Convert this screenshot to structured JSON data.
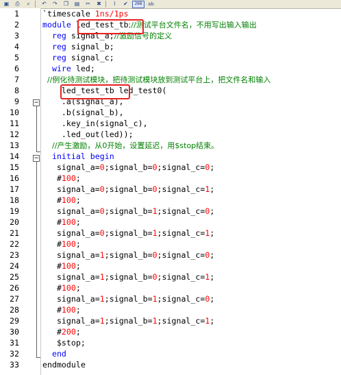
{
  "toolbar": {
    "buttons": [
      "save-icon",
      "print-icon",
      "find-icon",
      "undo-icon",
      "redo-icon",
      "copy-icon",
      "paste-icon",
      "cut-icon",
      "delete-icon",
      "paperclip-icon",
      "check-icon"
    ],
    "badge": "268",
    "ab_label": "ab"
  },
  "lines": [
    {
      "n": "1",
      "segs": [
        {
          "t": "`timescale ",
          "c": "tx"
        },
        {
          "t": "1ns/1ps",
          "c": "num"
        }
      ]
    },
    {
      "n": "2",
      "segs": [
        {
          "t": "module ",
          "c": "kw"
        },
        {
          "t": "led_test_tb",
          "c": "tx"
        },
        {
          "t": ";//测试平台文件名，不用写出输入输出",
          "c": "cm"
        }
      ]
    },
    {
      "n": "3",
      "segs": [
        {
          "t": "  reg ",
          "c": "kw"
        },
        {
          "t": "signal_a;",
          "c": "tx"
        },
        {
          "t": "//激励信号的定义",
          "c": "cm"
        }
      ]
    },
    {
      "n": "4",
      "segs": [
        {
          "t": "  reg ",
          "c": "kw"
        },
        {
          "t": "signal_b;",
          "c": "tx"
        }
      ]
    },
    {
      "n": "5",
      "segs": [
        {
          "t": "  reg ",
          "c": "kw"
        },
        {
          "t": "signal_c;",
          "c": "tx"
        }
      ]
    },
    {
      "n": "6",
      "segs": [
        {
          "t": "  wire ",
          "c": "kw"
        },
        {
          "t": "led;",
          "c": "tx"
        }
      ]
    },
    {
      "n": "7",
      "segs": [
        {
          "t": "  //例化待测试模块，把待测试模块放到测试平台上，把文件名和输入",
          "c": "cm"
        }
      ]
    },
    {
      "n": "8",
      "segs": [
        {
          "t": "    led_test_tb led_test0(",
          "c": "tx"
        }
      ]
    },
    {
      "n": "9",
      "segs": [
        {
          "t": "    .a(signal_a),",
          "c": "tx"
        }
      ]
    },
    {
      "n": "10",
      "segs": [
        {
          "t": "    .b(signal_b),",
          "c": "tx"
        }
      ]
    },
    {
      "n": "11",
      "segs": [
        {
          "t": "    .key_in(signal_c),",
          "c": "tx"
        }
      ]
    },
    {
      "n": "12",
      "segs": [
        {
          "t": "    .led_out(led));",
          "c": "tx"
        }
      ]
    },
    {
      "n": "13",
      "segs": [
        {
          "t": "    //产生激励，从0开始，设置延迟，用$stop结束。",
          "c": "cm"
        }
      ]
    },
    {
      "n": "14",
      "segs": [
        {
          "t": "  initial begin",
          "c": "kw"
        }
      ]
    },
    {
      "n": "15",
      "segs": [
        {
          "t": "   signal_a=",
          "c": "tx"
        },
        {
          "t": "0",
          "c": "num"
        },
        {
          "t": ";signal_b=",
          "c": "tx"
        },
        {
          "t": "0",
          "c": "num"
        },
        {
          "t": ";signal_c=",
          "c": "tx"
        },
        {
          "t": "0",
          "c": "num"
        },
        {
          "t": ";",
          "c": "tx"
        }
      ]
    },
    {
      "n": "16",
      "segs": [
        {
          "t": "   #",
          "c": "tx"
        },
        {
          "t": "100",
          "c": "num"
        },
        {
          "t": ";",
          "c": "tx"
        }
      ]
    },
    {
      "n": "17",
      "segs": [
        {
          "t": "   signal_a=",
          "c": "tx"
        },
        {
          "t": "0",
          "c": "num"
        },
        {
          "t": ";signal_b=",
          "c": "tx"
        },
        {
          "t": "0",
          "c": "num"
        },
        {
          "t": ";signal_c=",
          "c": "tx"
        },
        {
          "t": "1",
          "c": "num"
        },
        {
          "t": ";",
          "c": "tx"
        }
      ]
    },
    {
      "n": "18",
      "segs": [
        {
          "t": "   #",
          "c": "tx"
        },
        {
          "t": "100",
          "c": "num"
        },
        {
          "t": ";",
          "c": "tx"
        }
      ]
    },
    {
      "n": "19",
      "segs": [
        {
          "t": "   signal_a=",
          "c": "tx"
        },
        {
          "t": "0",
          "c": "num"
        },
        {
          "t": ";signal_b=",
          "c": "tx"
        },
        {
          "t": "1",
          "c": "num"
        },
        {
          "t": ";signal_c=",
          "c": "tx"
        },
        {
          "t": "0",
          "c": "num"
        },
        {
          "t": ";",
          "c": "tx"
        }
      ]
    },
    {
      "n": "20",
      "segs": [
        {
          "t": "   #",
          "c": "tx"
        },
        {
          "t": "100",
          "c": "num"
        },
        {
          "t": ";",
          "c": "tx"
        }
      ]
    },
    {
      "n": "21",
      "segs": [
        {
          "t": "   signal_a=",
          "c": "tx"
        },
        {
          "t": "0",
          "c": "num"
        },
        {
          "t": ";signal_b=",
          "c": "tx"
        },
        {
          "t": "1",
          "c": "num"
        },
        {
          "t": ";signal_c=",
          "c": "tx"
        },
        {
          "t": "1",
          "c": "num"
        },
        {
          "t": ";",
          "c": "tx"
        }
      ]
    },
    {
      "n": "22",
      "segs": [
        {
          "t": "   #",
          "c": "tx"
        },
        {
          "t": "100",
          "c": "num"
        },
        {
          "t": ";",
          "c": "tx"
        }
      ]
    },
    {
      "n": "23",
      "segs": [
        {
          "t": "   signal_a=",
          "c": "tx"
        },
        {
          "t": "1",
          "c": "num"
        },
        {
          "t": ";signal_b=",
          "c": "tx"
        },
        {
          "t": "0",
          "c": "num"
        },
        {
          "t": ";signal_c=",
          "c": "tx"
        },
        {
          "t": "0",
          "c": "num"
        },
        {
          "t": ";",
          "c": "tx"
        }
      ]
    },
    {
      "n": "24",
      "segs": [
        {
          "t": "   #",
          "c": "tx"
        },
        {
          "t": "100",
          "c": "num"
        },
        {
          "t": ";",
          "c": "tx"
        }
      ]
    },
    {
      "n": "25",
      "segs": [
        {
          "t": "   signal_a=",
          "c": "tx"
        },
        {
          "t": "1",
          "c": "num"
        },
        {
          "t": ";signal_b=",
          "c": "tx"
        },
        {
          "t": "0",
          "c": "num"
        },
        {
          "t": ";signal_c=",
          "c": "tx"
        },
        {
          "t": "1",
          "c": "num"
        },
        {
          "t": ";",
          "c": "tx"
        }
      ]
    },
    {
      "n": "26",
      "segs": [
        {
          "t": "   #",
          "c": "tx"
        },
        {
          "t": "100",
          "c": "num"
        },
        {
          "t": ";",
          "c": "tx"
        }
      ]
    },
    {
      "n": "27",
      "segs": [
        {
          "t": "   signal_a=",
          "c": "tx"
        },
        {
          "t": "1",
          "c": "num"
        },
        {
          "t": ";signal_b=",
          "c": "tx"
        },
        {
          "t": "1",
          "c": "num"
        },
        {
          "t": ";signal_c=",
          "c": "tx"
        },
        {
          "t": "0",
          "c": "num"
        },
        {
          "t": ";",
          "c": "tx"
        }
      ]
    },
    {
      "n": "28",
      "segs": [
        {
          "t": "   #",
          "c": "tx"
        },
        {
          "t": "100",
          "c": "num"
        },
        {
          "t": ";",
          "c": "tx"
        }
      ]
    },
    {
      "n": "29",
      "segs": [
        {
          "t": "   signal_a=",
          "c": "tx"
        },
        {
          "t": "1",
          "c": "num"
        },
        {
          "t": ";signal_b=",
          "c": "tx"
        },
        {
          "t": "1",
          "c": "num"
        },
        {
          "t": ";signal_c=",
          "c": "tx"
        },
        {
          "t": "1",
          "c": "num"
        },
        {
          "t": ";",
          "c": "tx"
        }
      ]
    },
    {
      "n": "30",
      "segs": [
        {
          "t": "   #",
          "c": "tx"
        },
        {
          "t": "200",
          "c": "num"
        },
        {
          "t": ";",
          "c": "tx"
        }
      ]
    },
    {
      "n": "31",
      "segs": [
        {
          "t": "   $stop;",
          "c": "tx"
        }
      ]
    },
    {
      "n": "32",
      "segs": [
        {
          "t": "  end",
          "c": "kw"
        }
      ]
    },
    {
      "n": "33",
      "segs": [
        {
          "t": "endmodule",
          "c": "tx"
        }
      ]
    }
  ],
  "colors": {
    "keyword": "#0000ff",
    "comment": "#008000",
    "number": "#ff0000",
    "highlight": "#e82020"
  }
}
